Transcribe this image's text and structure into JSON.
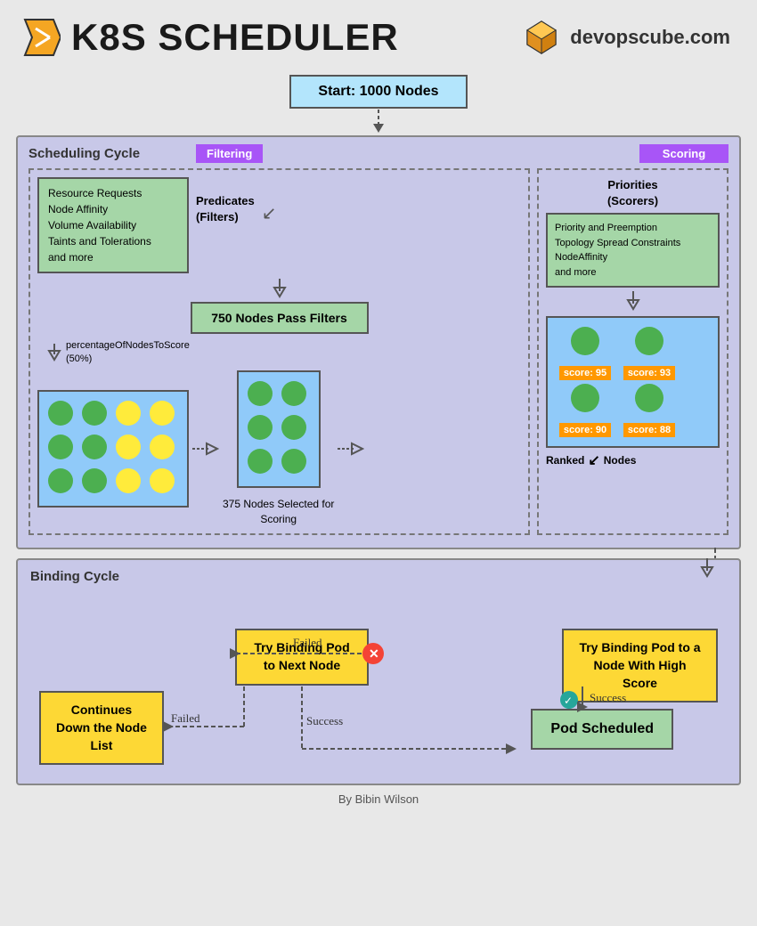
{
  "header": {
    "title": "K8S SCHEDULER",
    "site": "devopscube.com"
  },
  "diagram": {
    "start_label": "Start: 1000 Nodes",
    "scheduling_cycle_label": "Scheduling Cycle",
    "filtering_badge": "Filtering",
    "scoring_badge": "Scoring",
    "filter_box_lines": [
      "Resource Requests",
      "Node Affinity",
      "Volume Availability",
      "Taints and Tolerations",
      "and more"
    ],
    "predicates_label": "Predicates\n(Filters)",
    "nodes_pass": "750 Nodes Pass Filters",
    "percentage_label": "percentageOfNodesToScore\n(50%)",
    "priorities_label": "Priorities\n(Scorers)",
    "scorer_box_lines": [
      "Priority and Preemption",
      "Topology Spread Constraints",
      "NodeAffinity",
      "and more"
    ],
    "nodes_selected_label": "375 Nodes Selected for\nScoring",
    "ranked_nodes_label": "Ranked\nNodes",
    "scores": [
      "score: 95",
      "score: 93",
      "score: 90",
      "score: 88"
    ],
    "binding_cycle_label": "Binding Cycle",
    "try_binding_high": "Try Binding Pod to a Node\nWith High Score",
    "try_binding_next": "Try Binding Pod to\nNext Node",
    "continues_label": "Continues Down the\nNode List",
    "pod_scheduled": "Pod Scheduled",
    "failed_label": "Failed",
    "failed_label2": "Failed",
    "success_label": "Success",
    "success_label2": "Success",
    "footer": "By Bibin Wilson"
  }
}
